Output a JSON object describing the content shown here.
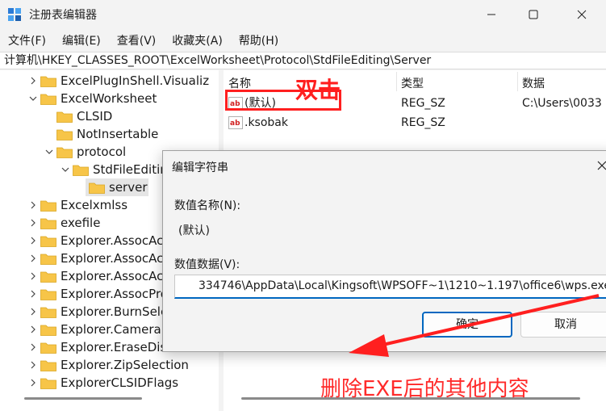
{
  "window": {
    "title": "注册表编辑器"
  },
  "menu": [
    {
      "label": "文件(F)"
    },
    {
      "label": "编辑(E)"
    },
    {
      "label": "查看(V)"
    },
    {
      "label": "收藏夹(A)"
    },
    {
      "label": "帮助(H)"
    }
  ],
  "address": {
    "path": "计算机\\HKEY_CLASSES_ROOT\\ExcelWorksheet\\Protocol\\StdFileEditing\\Server"
  },
  "tree": {
    "items": [
      {
        "label": "ExcelPlugInShell.Visualiz",
        "expanded": false
      },
      {
        "label": "ExcelWorksheet",
        "expanded": true
      },
      {
        "label": "CLSID"
      },
      {
        "label": "NotInsertable"
      },
      {
        "label": "protocol",
        "expanded": true
      },
      {
        "label": "StdFileEditin",
        "expanded": true
      },
      {
        "label": "server",
        "selected": true
      },
      {
        "label": "Excelxmlss",
        "expanded": false
      },
      {
        "label": "exefile",
        "expanded": false
      },
      {
        "label": "Explorer.AssocAc",
        "expanded": false
      },
      {
        "label": "Explorer.AssocAc",
        "expanded": false
      },
      {
        "label": "Explorer.AssocAc",
        "expanded": false
      },
      {
        "label": "Explorer.AssocPro",
        "expanded": false
      },
      {
        "label": "Explorer.BurnSele",
        "expanded": false
      },
      {
        "label": "Explorer.CameraR",
        "expanded": false
      },
      {
        "label": "Explorer.EraseDisc",
        "expanded": false
      },
      {
        "label": "Explorer.ZipSelection",
        "expanded": false
      },
      {
        "label": "ExplorerCLSIDFlags",
        "expanded": false
      }
    ]
  },
  "list": {
    "columns": [
      "名称",
      "类型",
      "数据"
    ],
    "rows": [
      {
        "name": "(默认)",
        "type": "REG_SZ",
        "data": "C:\\Users\\0033"
      },
      {
        "name": ".ksobak",
        "type": "REG_SZ",
        "data": ""
      }
    ]
  },
  "dialog": {
    "title": "编辑字符串",
    "name_label": "数值名称(N):",
    "name_value": "(默认)",
    "data_label": "数值数据(V):",
    "data_value": "334746\\AppData\\Local\\Kingsoft\\WPSOFF~1\\1210~1.197\\office6\\wps.exe",
    "ok_label": "确定",
    "cancel_label": "取消"
  },
  "annotations": {
    "double_click": "双击",
    "delete_note": "删除EXE后的其他内容",
    "color": "#ff1f1f"
  },
  "colors": {
    "accent": "#0067c0",
    "folder": "#f7c548"
  }
}
